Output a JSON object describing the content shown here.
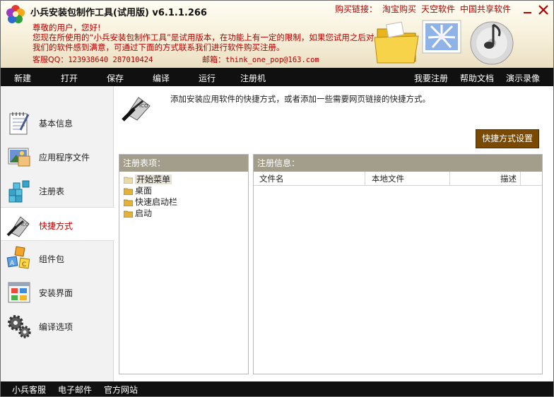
{
  "header": {
    "title": "小兵安装包制作工具(试用版) v6.1.1.266",
    "buy_prefix": "购买链接：",
    "buy_links": [
      "淘宝购买",
      "天空软件",
      "中国共享软件"
    ],
    "message_line1": "尊敬的用户，您好!",
    "message_line2": "您现在所使用的“小兵安装包制作工具”是试用版本，在功能上有一定的限制，如果您试用之后对我们的软件感到满意，可通过下面的方式联系我们进行软件购买注册。",
    "contact_label": "客服QQ：",
    "contact_value": "123938640  287010424",
    "mail_label": "邮箱：",
    "mail_value": "think_one_pop@163.com"
  },
  "menubar": {
    "left": [
      "新建",
      "打开",
      "保存",
      "编译",
      "运行",
      "注册机"
    ],
    "right": [
      "我要注册",
      "帮助文档",
      "演示录像"
    ]
  },
  "sidebar": {
    "items": [
      {
        "label": "基本信息",
        "icon": "notepad-icon"
      },
      {
        "label": "应用程序文件",
        "icon": "picture-icon"
      },
      {
        "label": "注册表",
        "icon": "registry-icon"
      },
      {
        "label": "快捷方式",
        "icon": "shortcut-icon"
      },
      {
        "label": "组件包",
        "icon": "abc-blocks-icon"
      },
      {
        "label": "安装界面",
        "icon": "window-icon"
      },
      {
        "label": "编译选项",
        "icon": "gears-icon"
      }
    ],
    "active_index": 3
  },
  "main": {
    "description": "添加安装应用软件的快捷方式，或者添加一些需要网页链接的快捷方式。",
    "settings_button": "快捷方式设置",
    "left_panel_title": "注册表项：",
    "tree_items": [
      "开始菜单",
      "桌面",
      "快速启动栏",
      "启动"
    ],
    "selected_tree_index": 0,
    "right_panel_title": "注册信息：",
    "columns": [
      "文件名",
      "本地文件",
      "描述"
    ]
  },
  "statusbar": {
    "items": [
      "小兵客服",
      "电子邮件",
      "官方网站"
    ]
  },
  "colors": {
    "accent_red": "#b40000",
    "toolbar_bg": "#101010",
    "button_brown": "#7a4a02",
    "panel_header": "#a39d8c"
  }
}
